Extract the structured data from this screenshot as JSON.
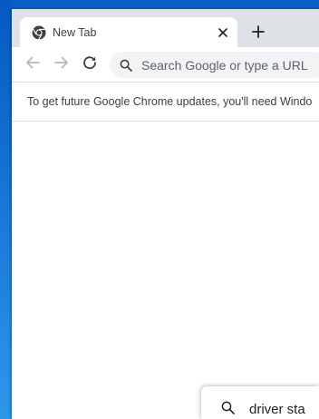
{
  "browser": {
    "tab": {
      "title": "New Tab",
      "favicon": "chrome-icon"
    },
    "new_tab_icon": "plus-icon",
    "toolbar": {
      "back_icon": "arrow-left-icon",
      "forward_icon": "arrow-right-icon",
      "reload_icon": "reload-icon",
      "omnibox_placeholder": "Search Google or type a URL"
    },
    "infobar": {
      "message": "To get future Google Chrome updates, you'll need Windo"
    }
  },
  "taskbar_search": {
    "icon": "search-icon",
    "query": "driver sta"
  },
  "colors": {
    "titlebar": "#dee1e6",
    "omnibox": "#f1f3f4",
    "desktop": "#1a7ad8"
  }
}
